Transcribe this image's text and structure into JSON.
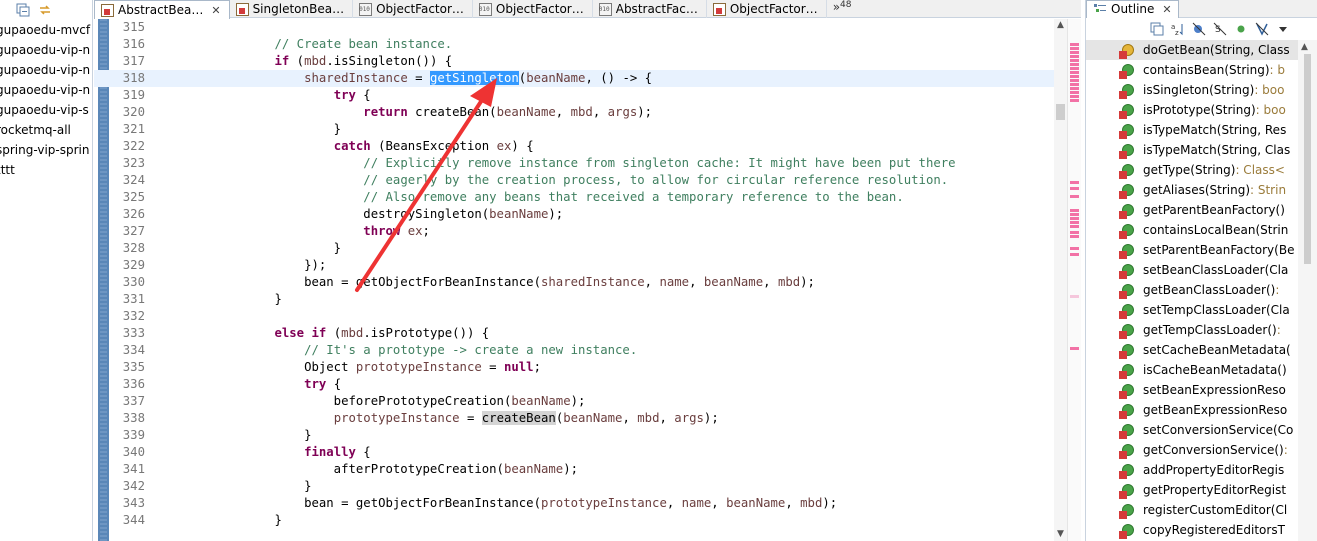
{
  "project_explorer": {
    "items": [
      "gupaoedu-mvcf",
      "gupaoedu-vip-n",
      "gupaoedu-vip-n",
      "gupaoedu-vip-n",
      "gupaoedu-vip-s",
      "rocketmq-all",
      "spring-vip-sprin",
      "tttt"
    ]
  },
  "editor": {
    "tabs": [
      {
        "label": "AbstractBea…",
        "icon": "java-class-icon",
        "active": true
      },
      {
        "label": "SingletonBea…",
        "icon": "java-class-icon",
        "active": false
      },
      {
        "label": "ObjectFactor…",
        "icon": "class-file-icon",
        "active": false
      },
      {
        "label": "ObjectFactor…",
        "icon": "class-file-icon",
        "active": false
      },
      {
        "label": "AbstractFac…",
        "icon": "class-file-icon",
        "active": false
      },
      {
        "label": "ObjectFactor…",
        "icon": "java-class-icon",
        "active": false
      }
    ],
    "overflow_label": "»",
    "overflow_count": "48",
    "close_glyph": "✕",
    "current_line": "318",
    "selected_text": "getSingleton",
    "lines": [
      {
        "n": "315",
        "t": ""
      },
      {
        "n": "316",
        "t": "                // Create bean instance."
      },
      {
        "n": "317",
        "t": "                if (mbd.isSingleton()) {"
      },
      {
        "n": "318",
        "t": "                    sharedInstance = getSingleton(beanName, () -> {"
      },
      {
        "n": "319",
        "t": "                        try {"
      },
      {
        "n": "320",
        "t": "                            return createBean(beanName, mbd, args);"
      },
      {
        "n": "321",
        "t": "                        }"
      },
      {
        "n": "322",
        "t": "                        catch (BeansException ex) {"
      },
      {
        "n": "323",
        "t": "                            // Explicitly remove instance from singleton cache: It might have been put there"
      },
      {
        "n": "324",
        "t": "                            // eagerly by the creation process, to allow for circular reference resolution."
      },
      {
        "n": "325",
        "t": "                            // Also remove any beans that received a temporary reference to the bean."
      },
      {
        "n": "326",
        "t": "                            destroySingleton(beanName);"
      },
      {
        "n": "327",
        "t": "                            throw ex;"
      },
      {
        "n": "328",
        "t": "                        }"
      },
      {
        "n": "329",
        "t": "                    });"
      },
      {
        "n": "330",
        "t": "                    bean = getObjectForBeanInstance(sharedInstance, name, beanName, mbd);"
      },
      {
        "n": "331",
        "t": "                }"
      },
      {
        "n": "332",
        "t": ""
      },
      {
        "n": "333",
        "t": "                else if (mbd.isPrototype()) {"
      },
      {
        "n": "334",
        "t": "                    // It's a prototype -> create a new instance."
      },
      {
        "n": "335",
        "t": "                    Object prototypeInstance = null;"
      },
      {
        "n": "336",
        "t": "                    try {"
      },
      {
        "n": "337",
        "t": "                        beforePrototypeCreation(beanName);"
      },
      {
        "n": "338",
        "t": "                        prototypeInstance = createBean(beanName, mbd, args);"
      },
      {
        "n": "339",
        "t": "                    }"
      },
      {
        "n": "340",
        "t": "                    finally {"
      },
      {
        "n": "341",
        "t": "                        afterPrototypeCreation(beanName);"
      },
      {
        "n": "342",
        "t": "                    }"
      },
      {
        "n": "343",
        "t": "                    bean = getObjectForBeanInstance(prototypeInstance, name, beanName, mbd);"
      },
      {
        "n": "344",
        "t": "                }"
      }
    ]
  },
  "outline": {
    "title": "Outline",
    "close_glyph": "✕",
    "items": [
      {
        "name": "doGetBean(String, Class",
        "type": "",
        "visibility": "protected",
        "selected": true
      },
      {
        "name": "containsBean(String)",
        "type": " : b",
        "visibility": "public"
      },
      {
        "name": "isSingleton(String)",
        "type": " : boo",
        "visibility": "public"
      },
      {
        "name": "isPrototype(String)",
        "type": " : boo",
        "visibility": "public"
      },
      {
        "name": "isTypeMatch(String, Res",
        "type": "",
        "visibility": "public"
      },
      {
        "name": "isTypeMatch(String, Clas",
        "type": "",
        "visibility": "public"
      },
      {
        "name": "getType(String)",
        "type": " : Class<",
        "visibility": "public"
      },
      {
        "name": "getAliases(String)",
        "type": " : Strin",
        "visibility": "public"
      },
      {
        "name": "getParentBeanFactory()",
        "type": "",
        "visibility": "public"
      },
      {
        "name": "containsLocalBean(Strin",
        "type": "",
        "visibility": "public"
      },
      {
        "name": "setParentBeanFactory(Be",
        "type": "",
        "visibility": "public"
      },
      {
        "name": "setBeanClassLoader(Cla",
        "type": "",
        "visibility": "public"
      },
      {
        "name": "getBeanClassLoader()",
        "type": " :",
        "visibility": "public"
      },
      {
        "name": "setTempClassLoader(Cla",
        "type": "",
        "visibility": "public"
      },
      {
        "name": "getTempClassLoader()",
        "type": " :",
        "visibility": "public"
      },
      {
        "name": "setCacheBeanMetadata(",
        "type": "",
        "visibility": "public"
      },
      {
        "name": "isCacheBeanMetadata()",
        "type": "",
        "visibility": "public"
      },
      {
        "name": "setBeanExpressionReso",
        "type": "",
        "visibility": "public"
      },
      {
        "name": "getBeanExpressionReso",
        "type": "",
        "visibility": "public"
      },
      {
        "name": "setConversionService(Co",
        "type": "",
        "visibility": "public"
      },
      {
        "name": "getConversionService()",
        "type": " :",
        "visibility": "public"
      },
      {
        "name": "addPropertyEditorRegis",
        "type": "",
        "visibility": "public"
      },
      {
        "name": "getPropertyEditorRegist",
        "type": "",
        "visibility": "public"
      },
      {
        "name": "registerCustomEditor(Cl",
        "type": "",
        "visibility": "public"
      },
      {
        "name": "copyRegisteredEditorsT",
        "type": "",
        "visibility": "public"
      }
    ]
  },
  "colors": {
    "keyword": "#7f0055",
    "comment": "#3f7f5f",
    "selection": "#3399ff",
    "current_line": "#e8f2fe",
    "annotation_arrow": "#ee3333"
  }
}
